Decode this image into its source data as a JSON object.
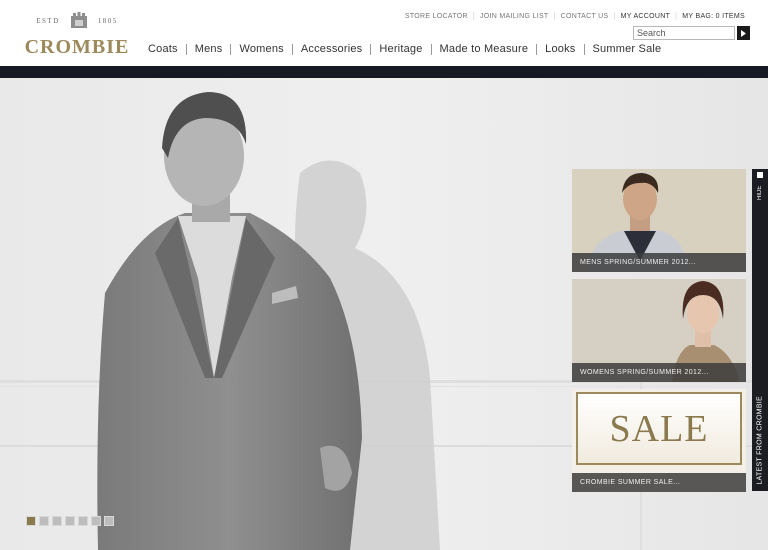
{
  "brand": {
    "estd": "ESTD",
    "year": "1805",
    "name": "CROMBIE"
  },
  "utility_links": [
    {
      "label": "STORE LOCATOR"
    },
    {
      "label": "JOIN MAILING LIST"
    },
    {
      "label": "CONTACT US"
    },
    {
      "label": "MY ACCOUNT"
    },
    {
      "label": "MY BAG: 0 ITEMS"
    }
  ],
  "search": {
    "placeholder": "Search",
    "button_icon": "arrow-right-icon"
  },
  "nav": [
    {
      "label": "Coats"
    },
    {
      "label": "Mens"
    },
    {
      "label": "Womens"
    },
    {
      "label": "Accessories"
    },
    {
      "label": "Heritage"
    },
    {
      "label": "Made to Measure"
    },
    {
      "label": "Looks"
    },
    {
      "label": "Summer Sale"
    }
  ],
  "slideshow": {
    "current": 1,
    "count": 7
  },
  "panel": {
    "cards": [
      {
        "caption": "MENS SPRING/SUMMER 2012..."
      },
      {
        "caption": "WOMENS SPRING/SUMMER 2012..."
      },
      {
        "caption": "CROMBIE SUMMER SALE...",
        "image_text": "SALE"
      }
    ],
    "tab": {
      "hide_label": "HIDE",
      "title": "LATEST FROM CROMBIE"
    }
  },
  "colors": {
    "brand_gold": "#9c8a5c",
    "nav_band": "#171a23",
    "caption_bg": "#3c3c3c"
  }
}
